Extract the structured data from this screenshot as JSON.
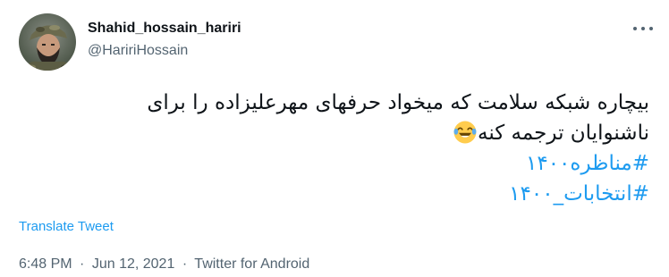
{
  "author": {
    "display_name": "Shahid_hossain_hariri",
    "handle": "@HaririHossain"
  },
  "tweet": {
    "line1": "بیچاره شبکه سلامت که میخواد حرفهای مهرعلیزاده را برای",
    "line2": "ناشنوایان ترجمه کنه",
    "emoji": "face-with-tears-of-joy",
    "hashtags": [
      "#مناظره۱۴۰۰",
      "#انتخابات_۱۴۰۰"
    ]
  },
  "translate_label": "Translate Tweet",
  "meta": {
    "time": "6:48 PM",
    "separator": "·",
    "date": "Jun 12, 2021",
    "source": "Twitter for Android"
  },
  "colors": {
    "link": "#1d9bf0",
    "secondary_text": "#536471",
    "primary_text": "#0f1419"
  }
}
